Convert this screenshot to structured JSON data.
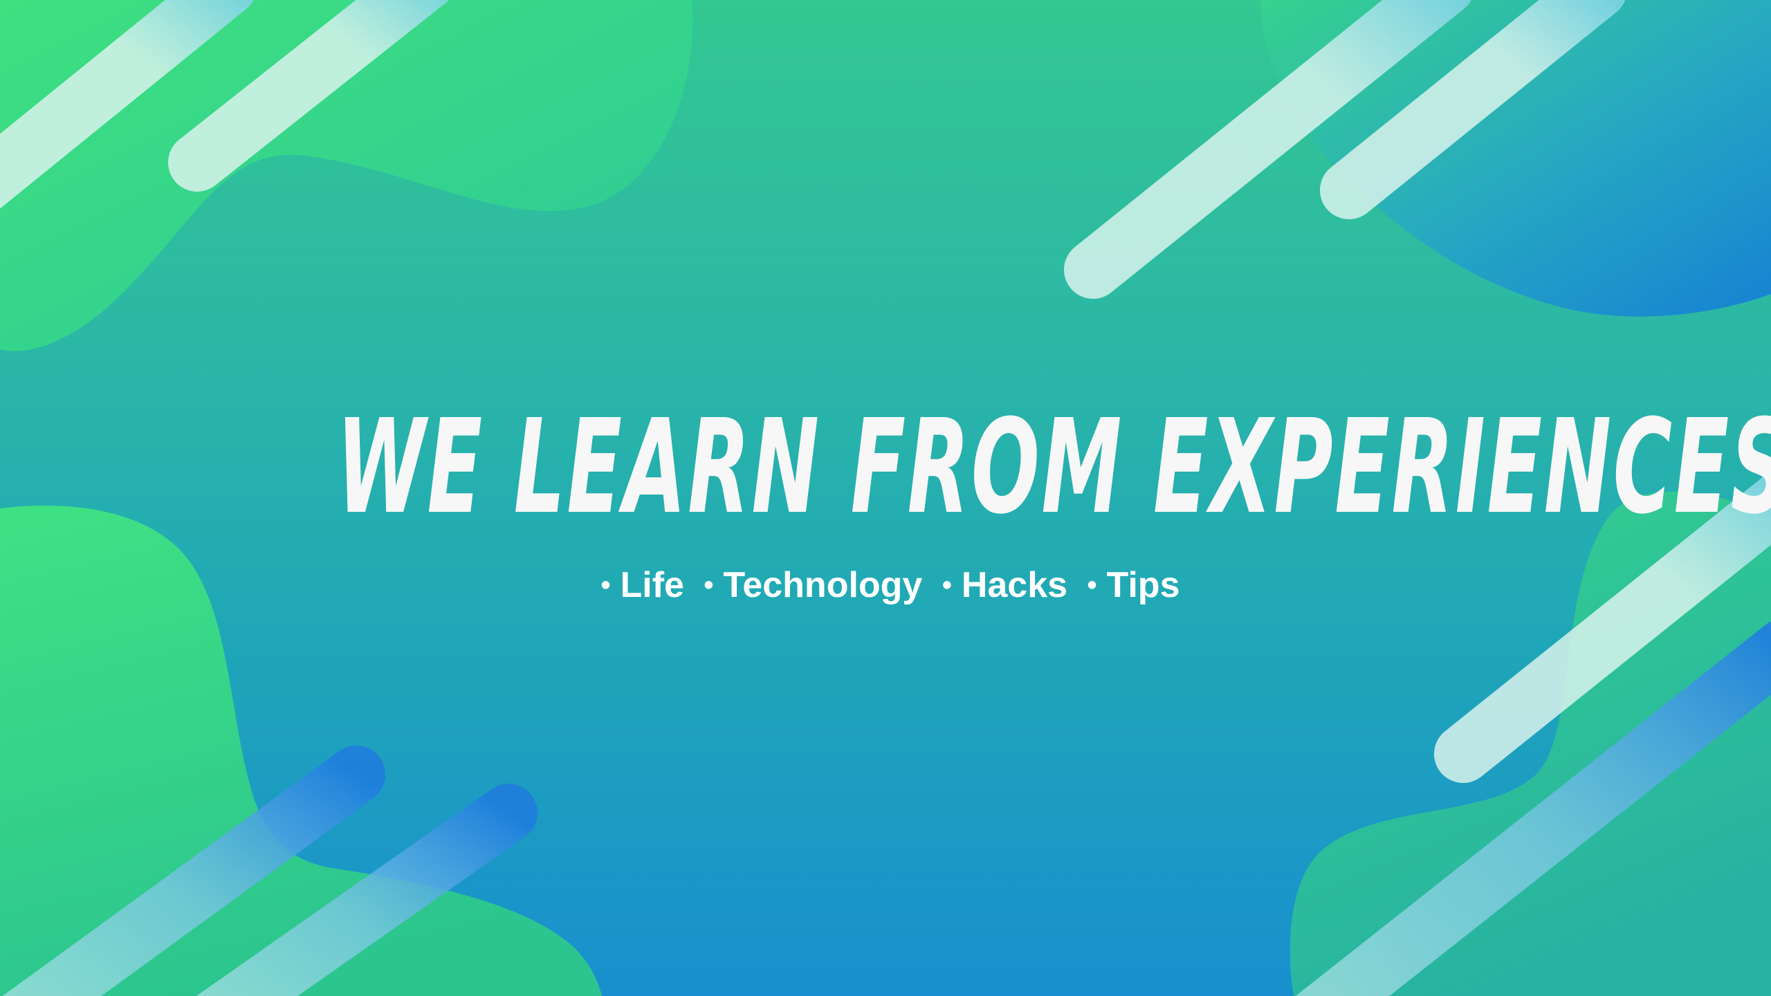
{
  "headline": "WE LEARN FROM EXPERIENCES",
  "tagline": {
    "bullet": "•",
    "items": [
      "Life",
      "Technology",
      "Hacks",
      "Tips"
    ]
  },
  "colors": {
    "background_top": "#33c792",
    "background_bottom": "#198fcf",
    "blob_green": "#3ee07f",
    "blob_blue": "#1b86d6",
    "stripe": "#d9f3ec",
    "text": "#f7f7f7"
  }
}
